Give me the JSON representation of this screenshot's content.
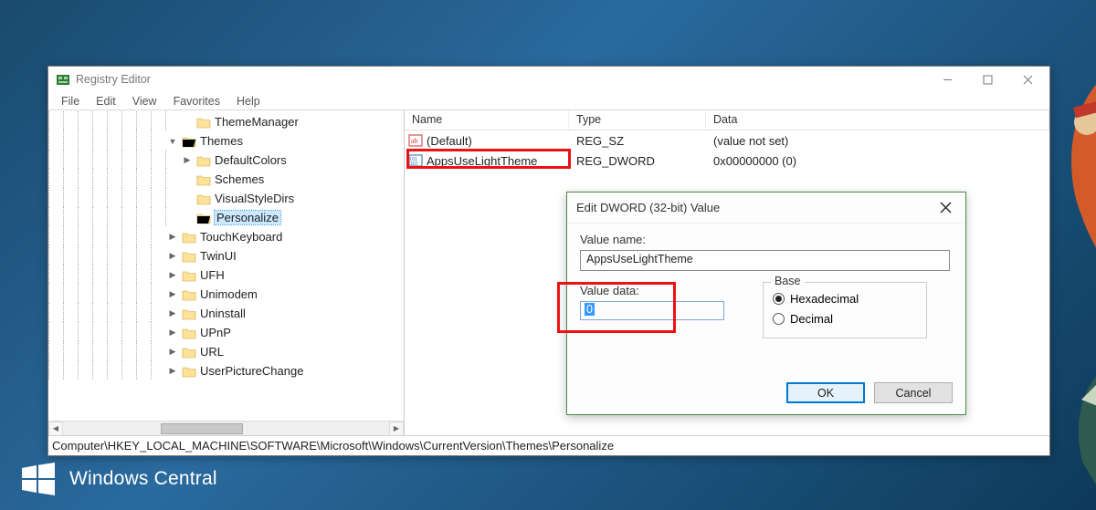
{
  "window": {
    "title": "Registry Editor",
    "menu": [
      "File",
      "Edit",
      "View",
      "Favorites",
      "Help"
    ]
  },
  "tree": {
    "rows": [
      {
        "depth": 9,
        "exp": "",
        "label": "ThemeManager"
      },
      {
        "depth": 8,
        "exp": "v",
        "icon": "open",
        "label": "Themes"
      },
      {
        "depth": 9,
        "exp": ">",
        "label": "DefaultColors"
      },
      {
        "depth": 9,
        "exp": "",
        "label": "Schemes"
      },
      {
        "depth": 9,
        "exp": "",
        "label": "VisualStyleDirs"
      },
      {
        "depth": 9,
        "exp": "",
        "icon": "open",
        "label": "Personalize",
        "selected": true
      },
      {
        "depth": 8,
        "exp": ">",
        "label": "TouchKeyboard"
      },
      {
        "depth": 8,
        "exp": ">",
        "label": "TwinUI"
      },
      {
        "depth": 8,
        "exp": ">",
        "label": "UFH"
      },
      {
        "depth": 8,
        "exp": ">",
        "label": "Unimodem"
      },
      {
        "depth": 8,
        "exp": ">",
        "label": "Uninstall"
      },
      {
        "depth": 8,
        "exp": ">",
        "label": "UPnP"
      },
      {
        "depth": 8,
        "exp": ">",
        "label": "URL"
      },
      {
        "depth": 8,
        "exp": ">",
        "label": "UserPictureChange"
      }
    ]
  },
  "list": {
    "columns": {
      "name": "Name",
      "type": "Type",
      "data": "Data"
    },
    "rows": [
      {
        "icon": "str",
        "name": "(Default)",
        "type": "REG_SZ",
        "data": "(value not set)"
      },
      {
        "icon": "bin",
        "name": "AppsUseLightTheme",
        "type": "REG_DWORD",
        "data": "0x00000000 (0)"
      }
    ]
  },
  "path": "Computer\\HKEY_LOCAL_MACHINE\\SOFTWARE\\Microsoft\\Windows\\CurrentVersion\\Themes\\Personalize",
  "dialog": {
    "title": "Edit DWORD (32-bit) Value",
    "value_name_label": "Value name:",
    "value_name": "AppsUseLightTheme",
    "value_data_label": "Value data:",
    "value_data": "0",
    "base_label": "Base",
    "radio_hex": "Hexadecimal",
    "radio_dec": "Decimal",
    "selected_base": "hex",
    "ok": "OK",
    "cancel": "Cancel"
  },
  "watermark": "Windows Central"
}
